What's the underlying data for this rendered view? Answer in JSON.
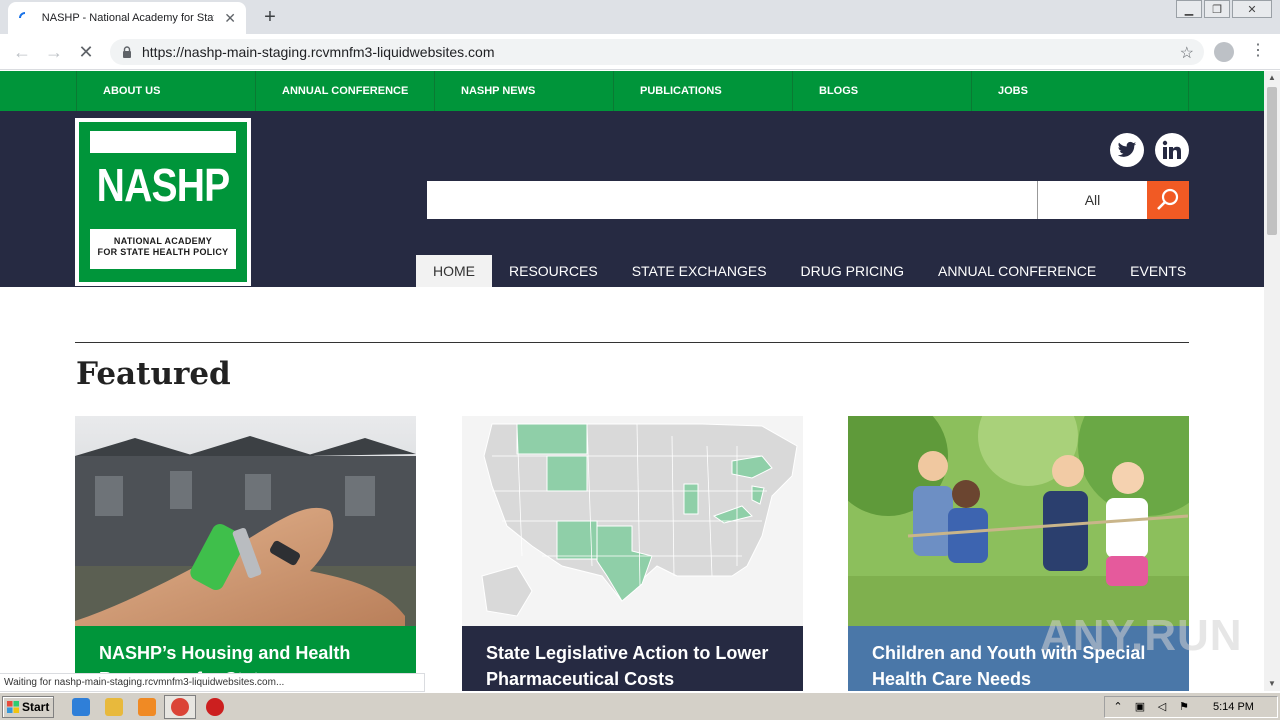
{
  "browser": {
    "tab_title": "NASHP - National Academy for State",
    "tab_close": "✕",
    "new_tab": "+",
    "url": "https://nashp-main-staging.rcvmnfm3-liquidwebsites.com",
    "status_text": "Waiting for nashp-main-staging.rcvmnfm3-liquidwebsites.com..."
  },
  "topnav": {
    "items": [
      "ABOUT US",
      "ANNUAL CONFERENCE",
      "NASHP NEWS",
      "PUBLICATIONS",
      "BLOGS",
      "JOBS"
    ]
  },
  "logo": {
    "name": "NASHP",
    "subtitle_line1": "NATIONAL ACADEMY",
    "subtitle_line2": "FOR STATE HEALTH POLICY"
  },
  "search": {
    "value": "",
    "scope": "All"
  },
  "mainnav": {
    "items": [
      "HOME",
      "RESOURCES",
      "STATE EXCHANGES",
      "DRUG PRICING",
      "ANNUAL CONFERENCE",
      "EVENTS"
    ],
    "active": "HOME"
  },
  "featured": {
    "title": "Featured",
    "cards": [
      {
        "caption": "NASHP’s Housing and Health Resources for States",
        "color": "#00953a"
      },
      {
        "caption": "State Legislative Action to Lower Pharmaceutical Costs",
        "color": "#262a42"
      },
      {
        "caption": "Children and Youth with Special Health Care Needs",
        "color": "#4a77a8"
      }
    ]
  },
  "watermark": "ANY.RUN",
  "taskbar": {
    "start_label": "Start",
    "clock": "5:14 PM"
  },
  "colors": {
    "green": "#00953a",
    "navy": "#262a42",
    "orange": "#f15a24"
  }
}
